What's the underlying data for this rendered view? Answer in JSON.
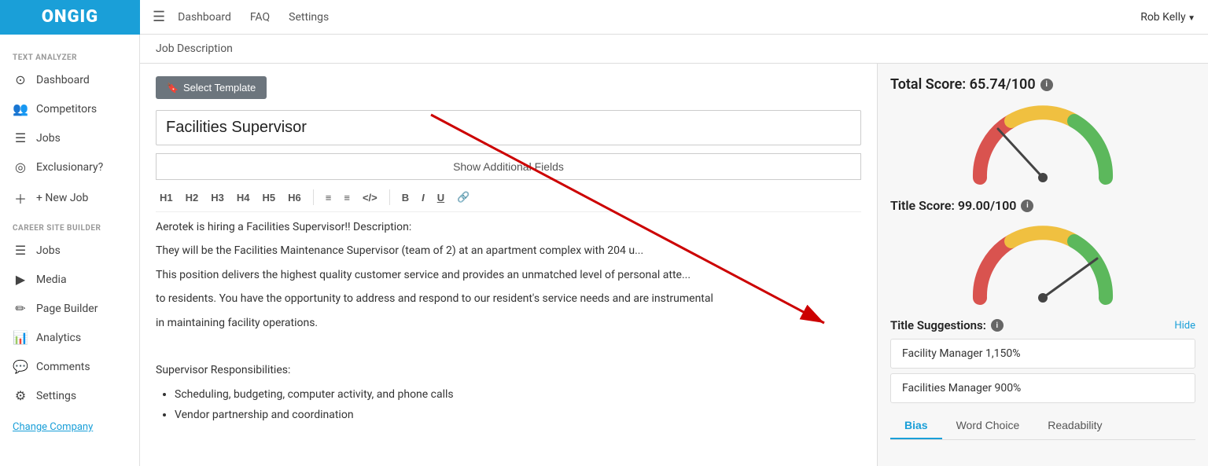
{
  "logo": "ONGIG",
  "topnav": {
    "hamburger": "☰",
    "links": [
      "Dashboard",
      "FAQ",
      "Settings"
    ],
    "user": "Rob Kelly"
  },
  "sidebar": {
    "section1_label": "TEXT ANALYZER",
    "items1": [
      {
        "label": "Dashboard",
        "icon": "⊙"
      },
      {
        "label": "Competitors",
        "icon": "👥"
      },
      {
        "label": "Jobs",
        "icon": "☰"
      },
      {
        "label": "Exclusionary?",
        "icon": "◎"
      },
      {
        "label": "+ New Job",
        "icon": ""
      }
    ],
    "section2_label": "CAREER SITE BUILDER",
    "items2": [
      {
        "label": "Jobs",
        "icon": "☰"
      },
      {
        "label": "Media",
        "icon": "🎬"
      },
      {
        "label": "Page Builder",
        "icon": "✏"
      },
      {
        "label": "Analytics",
        "icon": "📊"
      },
      {
        "label": "Comments",
        "icon": "💬"
      },
      {
        "label": "Settings",
        "icon": "⚙"
      }
    ],
    "change_company": "Change Company"
  },
  "breadcrumb": "Job Description",
  "editor": {
    "template_btn": "Select Template",
    "title_placeholder": "Facilities Supervisor",
    "show_fields_btn": "Show Additional Fields",
    "toolbar": {
      "headings": [
        "H1",
        "H2",
        "H3",
        "H4",
        "H5",
        "H6"
      ],
      "list_icons": [
        "≡",
        "≡",
        "</>"
      ],
      "format_icons": [
        "B",
        "I",
        "U",
        "🔗"
      ]
    },
    "content": {
      "para1": "Aerotek is hiring a Facilities Supervisor!! Description:",
      "para2": "They will be the Facilities Maintenance Supervisor (team of 2) at an apartment complex with 204 u...",
      "para3": "This position delivers the highest quality customer service and provides an unmatched level of personal atte...",
      "para4": "to residents. You have the opportunity to address and respond to our resident's service needs and are instrumental",
      "para5": "in maintaining facility operations.",
      "heading2": "Supervisor Responsibilities:",
      "bullets": [
        "Scheduling, budgeting, computer activity, and phone calls",
        "Vendor partnership and coordination"
      ]
    }
  },
  "right_panel": {
    "total_score_label": "Total Score: 65.74/100",
    "title_score_label": "Title Score: 99.00/100",
    "suggestions_label": "Title Suggestions:",
    "hide_label": "Hide",
    "suggestions": [
      "Facility Manager 1,150%",
      "Facilities Manager 900%"
    ],
    "tabs": [
      "Bias",
      "Word Choice",
      "Readability"
    ],
    "active_tab": "Bias"
  }
}
